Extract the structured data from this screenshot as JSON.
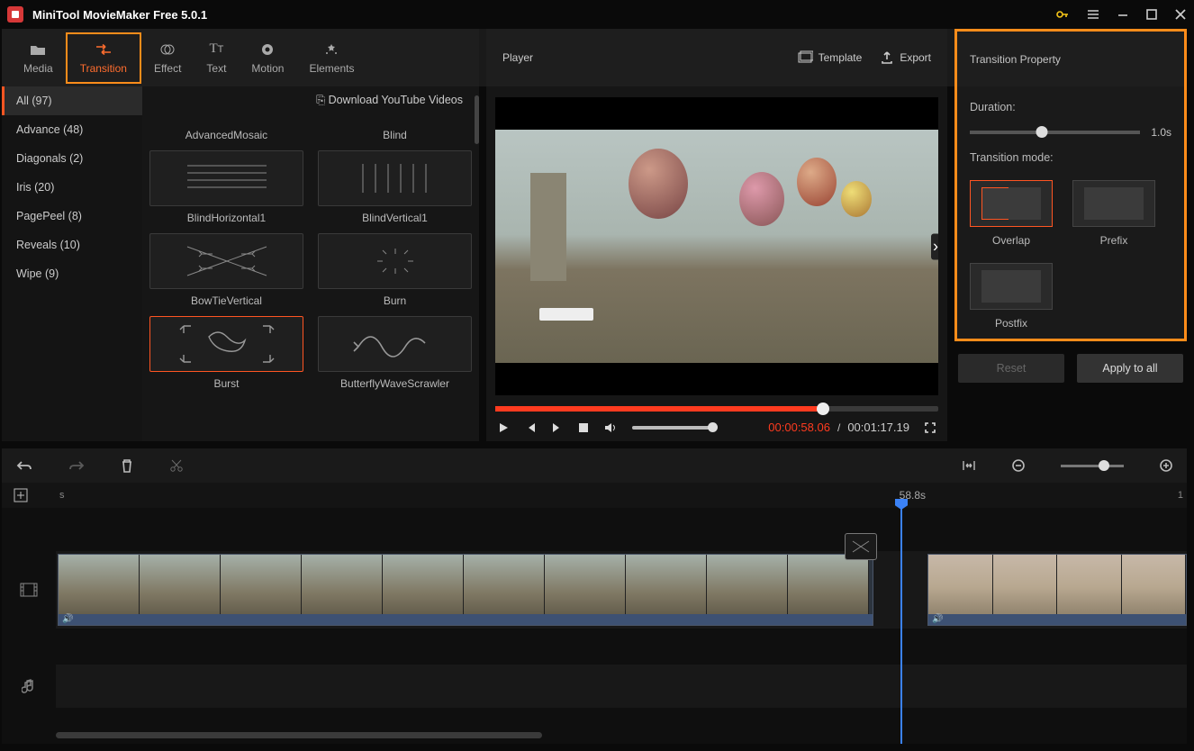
{
  "app": {
    "title": "MiniTool MovieMaker Free 5.0.1"
  },
  "tabs": {
    "media": "Media",
    "transition": "Transition",
    "effect": "Effect",
    "text": "Text",
    "motion": "Motion",
    "elements": "Elements"
  },
  "player_header": {
    "title": "Player",
    "template": "Template",
    "export": "Export"
  },
  "categories": [
    "All (97)",
    "Advance (48)",
    "Diagonals (2)",
    "Iris (20)",
    "PagePeel (8)",
    "Reveals (10)",
    "Wipe (9)"
  ],
  "download_link": "Download YouTube Videos",
  "transitions": [
    {
      "name": "AdvancedMosaic"
    },
    {
      "name": "Blind"
    },
    {
      "name": "BlindHorizontal1"
    },
    {
      "name": "BlindVertical1"
    },
    {
      "name": "BowTieVertical"
    },
    {
      "name": "Burn"
    },
    {
      "name": "Burst",
      "selected": true
    },
    {
      "name": "ButterflyWaveScrawler"
    }
  ],
  "playback": {
    "current": "00:00:58.06",
    "separator": "/",
    "total": "00:01:17.19"
  },
  "properties": {
    "title": "Transition Property",
    "duration_label": "Duration:",
    "duration_value": "1.0s",
    "mode_label": "Transition mode:",
    "modes": {
      "overlap": "Overlap",
      "prefix": "Prefix",
      "postfix": "Postfix"
    },
    "reset": "Reset",
    "apply_all": "Apply to all"
  },
  "timeline": {
    "start_label": "s",
    "playhead_time": "58.8s",
    "end_label": "1"
  }
}
